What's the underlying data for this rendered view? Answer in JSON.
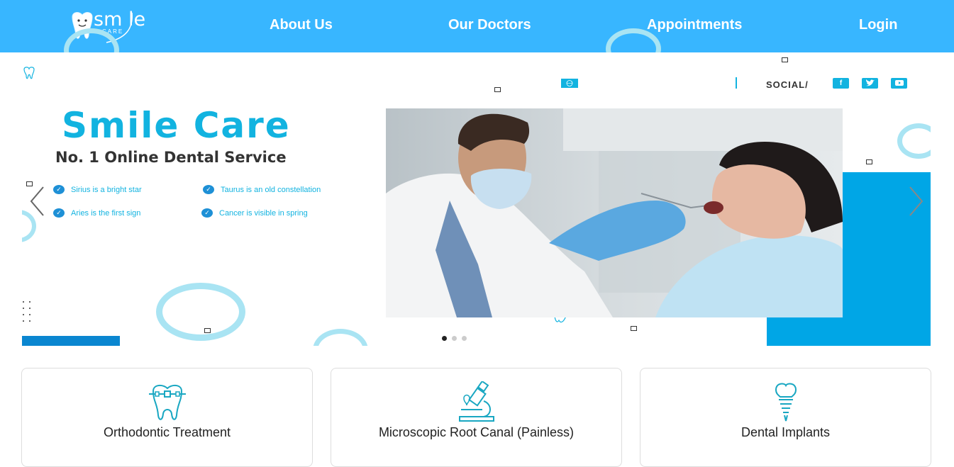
{
  "nav": {
    "logo_text": "sm le",
    "logo_sub": "CARE",
    "links": [
      "About Us",
      "Our Doctors",
      "Appointments",
      "Login"
    ]
  },
  "hero": {
    "title": "Smile Care",
    "subtitle": "No. 1 Online Dental Service",
    "features": [
      "Sirius is a bright star",
      "Taurus is an old constellation",
      "Aries is the first sign",
      "Cancer is visible in spring"
    ],
    "social_label": "SOCIAL/",
    "social_icons": [
      "facebook-icon",
      "twitter-icon",
      "youtube-icon"
    ],
    "slides": 3,
    "active_slide": 1
  },
  "services": [
    {
      "label": "Orthodontic Treatment",
      "icon": "braces-tooth-icon"
    },
    {
      "label": "Microscopic Root Canal (Painless)",
      "icon": "microscope-icon"
    },
    {
      "label": "Dental Implants",
      "icon": "dental-implant-icon"
    }
  ],
  "colors": {
    "nav_bg": "#38b6ff",
    "accent": "#12b3e0",
    "accent_dark": "#00a6e6"
  }
}
